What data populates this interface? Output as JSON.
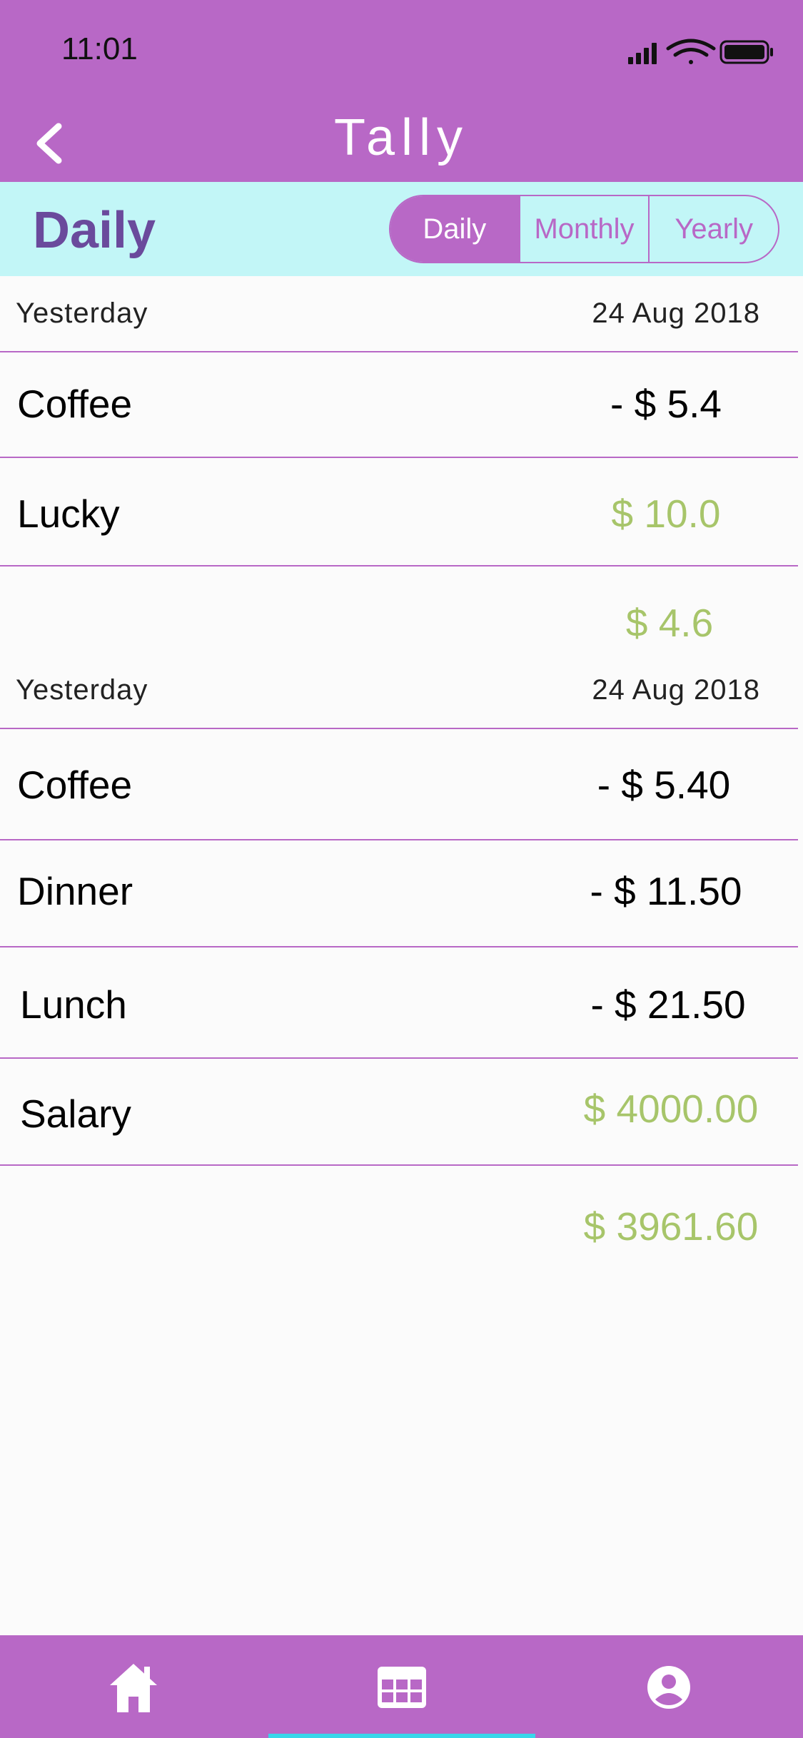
{
  "status_bar": {
    "time": "11:01"
  },
  "nav": {
    "title": "Tally"
  },
  "header": {
    "heading": "Daily",
    "segments": [
      "Daily",
      "Monthly",
      "Yearly"
    ],
    "selected": "Daily"
  },
  "groups": [
    {
      "date_label": "Yesterday",
      "date": "24 Aug 2018",
      "items": [
        {
          "label": "Coffee",
          "amount": "- $ 5.4"
        },
        {
          "label": "Lucky",
          "amount": "$ 10.0"
        }
      ],
      "total": "$ 4.6"
    },
    {
      "date_label": "Yesterday",
      "date": "24 Aug 2018",
      "items": [
        {
          "label": "Coffee",
          "amount": "- $ 5.40"
        },
        {
          "label": "Dinner",
          "amount": "- $ 11.50"
        },
        {
          "label": "Lunch",
          "amount": "- $ 21.50"
        },
        {
          "label": "Salary",
          "amount": "$ 4000.00"
        }
      ],
      "total": "$ 3961.60"
    }
  ],
  "tabbar": {
    "icons": [
      "home-icon",
      "calendar-grid-icon",
      "account-icon"
    ]
  },
  "colors": {
    "accent": "#b868c6",
    "subbar": "#c2f6f7",
    "positive": "#a7c56a",
    "heading": "#6a4a9c"
  }
}
